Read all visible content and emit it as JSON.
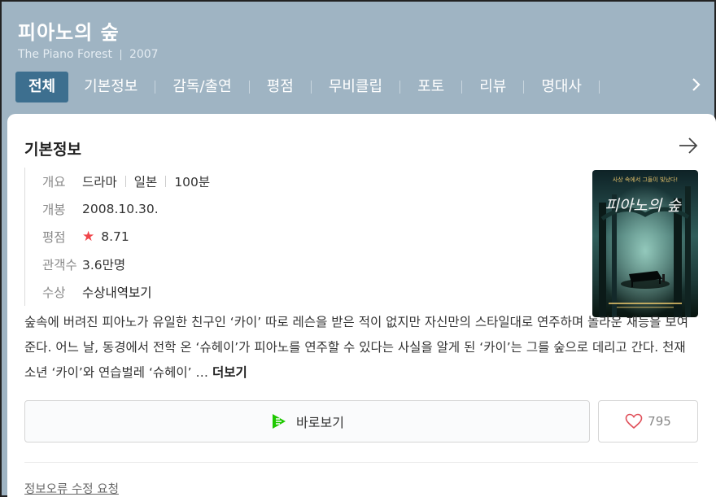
{
  "header": {
    "title": "피아노의 숲",
    "subtitle_en": "The Piano Forest",
    "year": "2007"
  },
  "tabs": [
    {
      "label": "전체",
      "active": true
    },
    {
      "label": "기본정보"
    },
    {
      "label": "감독/출연"
    },
    {
      "label": "평점"
    },
    {
      "label": "무비클립"
    },
    {
      "label": "포토"
    },
    {
      "label": "리뷰"
    },
    {
      "label": "명대사"
    }
  ],
  "card": {
    "title": "기본정보",
    "info": {
      "summary_label": "개요",
      "genre": "드라마",
      "country": "일본",
      "runtime": "100분",
      "release_label": "개봉",
      "release_date": "2008.10.30.",
      "rating_label": "평점",
      "rating": "8.71",
      "audience_label": "관객수",
      "audience": "3.6만명",
      "award_label": "수상",
      "award_link": "수상내역보기"
    },
    "poster": {
      "title": "피아노의 숲",
      "tagline": "사상 속에서 그들이 빛났다!"
    },
    "synopsis": "숲속에 버려진 피아노가 유일한 친구인 ‘카이’ 따로 레슨을 받은 적이 없지만 자신만의 스타일대로 연주하며 놀라운 재능을 보여준다. 어느 날, 동경에서 전학 온 ‘슈헤이’가 피아노를 연주할 수 있다는 사실을 알게 된 ‘카이’는 그를 숲으로 데리고 간다. 천재 소년 ‘카이’와 연습벌레 ‘슈헤이’ …",
    "more_label": "더보기",
    "watch_label": "바로보기",
    "like_count": "795",
    "report_label": "정보오류 수정 요청"
  },
  "colors": {
    "header_bg": "#9fb4c3",
    "active_tab": "#3d6f8f",
    "star": "#f0464b",
    "watch_icon": "#1ec800"
  }
}
